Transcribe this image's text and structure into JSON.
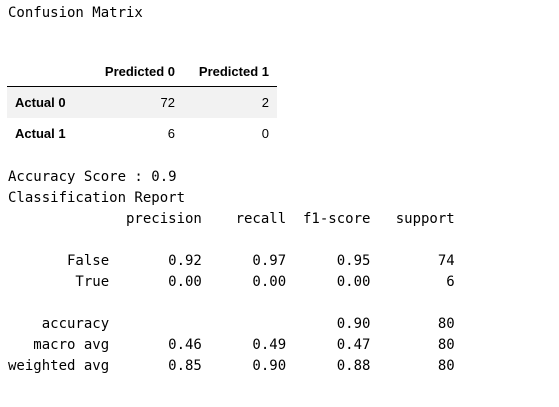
{
  "heading": "Confusion Matrix",
  "confusion_matrix": {
    "columns": [
      "",
      "Predicted 0",
      "Predicted 1"
    ],
    "rows": [
      {
        "label": "Actual 0",
        "values": [
          "72",
          "2"
        ]
      },
      {
        "label": "Actual 1",
        "values": [
          "6",
          "0"
        ]
      }
    ]
  },
  "accuracy_line": "Accuracy Score : 0.9",
  "report_title": "Classification Report",
  "report_header": "              precision    recall  f1-score   support",
  "report_lines": [
    "",
    "       False       0.92      0.97      0.95        74",
    "        True       0.00      0.00      0.00         6",
    "",
    "    accuracy                           0.90        80",
    "   macro avg       0.46      0.49      0.47        80",
    "weighted avg       0.85      0.90      0.88        80"
  ]
}
